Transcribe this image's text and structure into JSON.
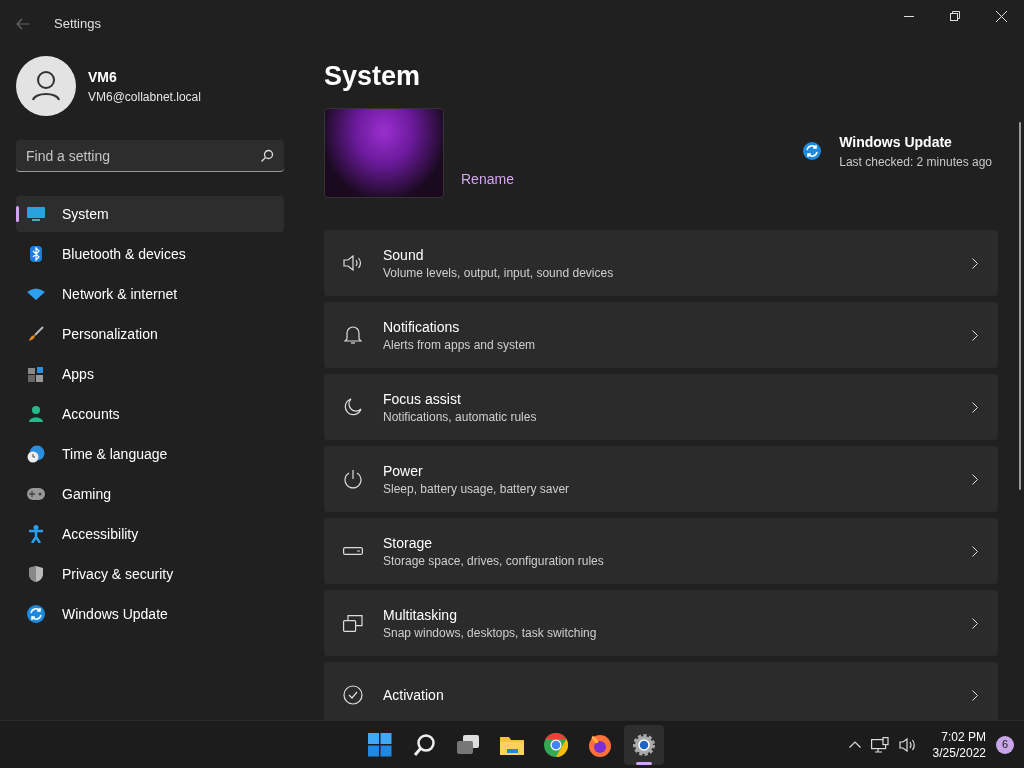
{
  "window": {
    "title": "Settings"
  },
  "account": {
    "name": "VM6",
    "email": "VM6@collabnet.local"
  },
  "search": {
    "placeholder": "Find a setting"
  },
  "sidebar": {
    "items": [
      {
        "label": "System",
        "selected": true
      },
      {
        "label": "Bluetooth & devices",
        "selected": false
      },
      {
        "label": "Network & internet",
        "selected": false
      },
      {
        "label": "Personalization",
        "selected": false
      },
      {
        "label": "Apps",
        "selected": false
      },
      {
        "label": "Accounts",
        "selected": false
      },
      {
        "label": "Time & language",
        "selected": false
      },
      {
        "label": "Gaming",
        "selected": false
      },
      {
        "label": "Accessibility",
        "selected": false
      },
      {
        "label": "Privacy & security",
        "selected": false
      },
      {
        "label": "Windows Update",
        "selected": false
      }
    ]
  },
  "page": {
    "title": "System",
    "rename": "Rename",
    "update": {
      "title": "Windows Update",
      "subtitle": "Last checked: 2 minutes ago"
    }
  },
  "settings": [
    {
      "title": "Sound",
      "subtitle": "Volume levels, output, input, sound devices"
    },
    {
      "title": "Notifications",
      "subtitle": "Alerts from apps and system"
    },
    {
      "title": "Focus assist",
      "subtitle": "Notifications, automatic rules"
    },
    {
      "title": "Power",
      "subtitle": "Sleep, battery usage, battery saver"
    },
    {
      "title": "Storage",
      "subtitle": "Storage space, drives, configuration rules"
    },
    {
      "title": "Multitasking",
      "subtitle": "Snap windows, desktops, task switching"
    },
    {
      "title": "Activation"
    }
  ],
  "taskbar": {
    "apps": [
      {
        "selected": false
      },
      {
        "selected": false
      },
      {
        "selected": false
      },
      {
        "selected": false
      },
      {
        "selected": false
      },
      {
        "selected": false
      },
      {
        "selected": true
      }
    ],
    "time": "7:02 PM",
    "date": "3/25/2022",
    "notifications": "6"
  }
}
